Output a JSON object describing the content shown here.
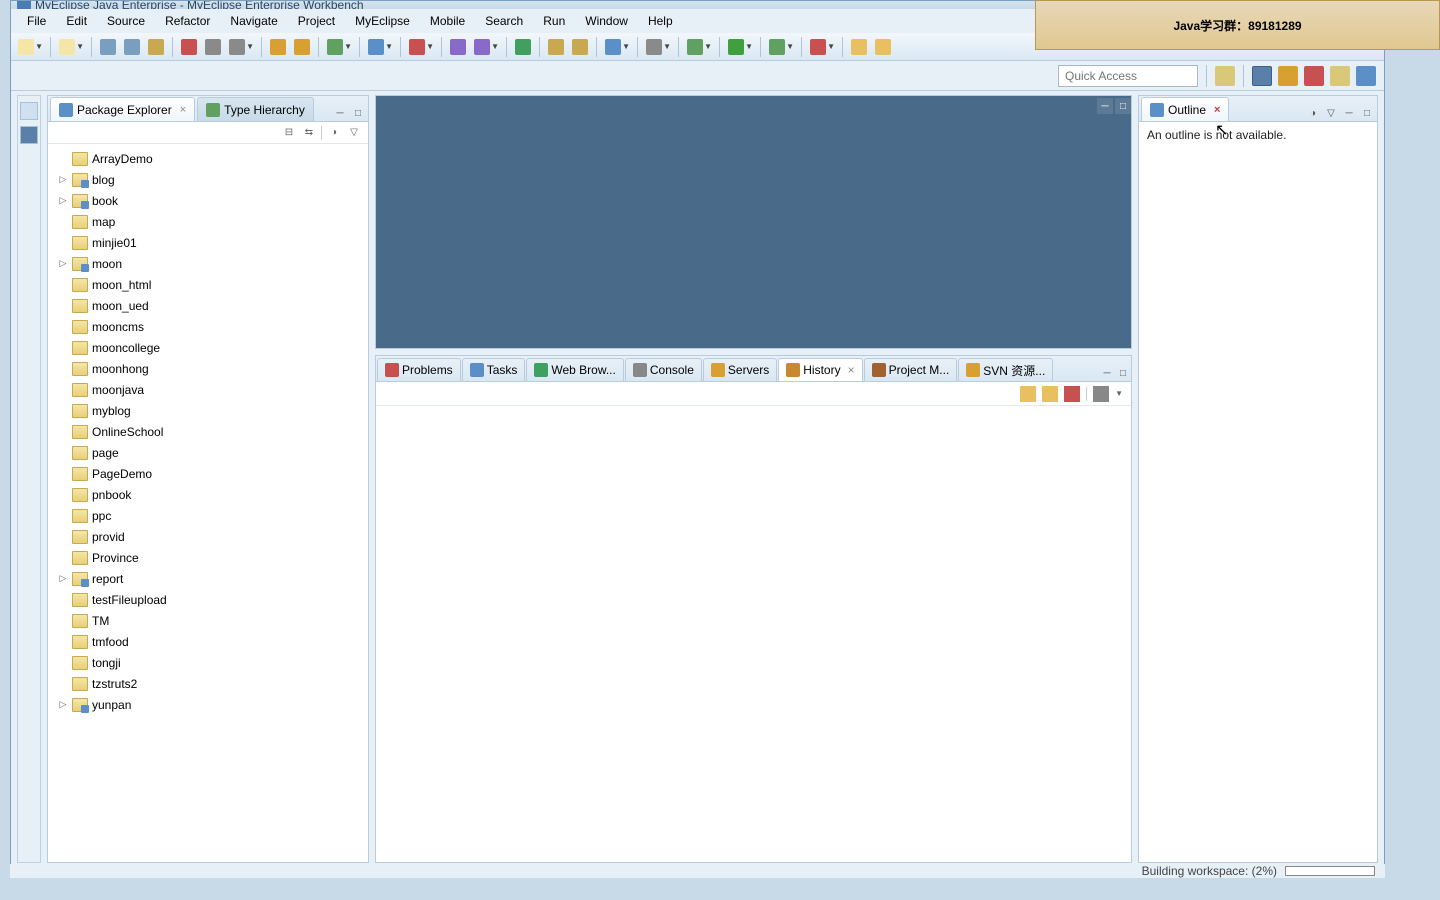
{
  "title": "MyEclipse Java Enterprise - MyEclipse Enterprise Workbench",
  "menu": [
    "File",
    "Edit",
    "Source",
    "Refactor",
    "Navigate",
    "Project",
    "MyEclipse",
    "Mobile",
    "Search",
    "Run",
    "Window",
    "Help"
  ],
  "quickAccess": {
    "placeholder": "Quick Access"
  },
  "leftTabs": {
    "pkg": "Package Explorer",
    "type": "Type Hierarchy"
  },
  "projects": [
    {
      "name": "ArrayDemo",
      "kind": "f",
      "exp": false
    },
    {
      "name": "blog",
      "kind": "p",
      "exp": true
    },
    {
      "name": "book",
      "kind": "p",
      "exp": true
    },
    {
      "name": "map",
      "kind": "f",
      "exp": false
    },
    {
      "name": "minjie01",
      "kind": "f",
      "exp": false
    },
    {
      "name": "moon",
      "kind": "p",
      "exp": true
    },
    {
      "name": "moon_html",
      "kind": "f",
      "exp": false
    },
    {
      "name": "moon_ued",
      "kind": "f",
      "exp": false
    },
    {
      "name": "mooncms",
      "kind": "f",
      "exp": false
    },
    {
      "name": "mooncollege",
      "kind": "f",
      "exp": false
    },
    {
      "name": "moonhong",
      "kind": "f",
      "exp": false
    },
    {
      "name": "moonjava",
      "kind": "f",
      "exp": false
    },
    {
      "name": "myblog",
      "kind": "f",
      "exp": false
    },
    {
      "name": "OnlineSchool",
      "kind": "f",
      "exp": false
    },
    {
      "name": "page",
      "kind": "f",
      "exp": false
    },
    {
      "name": "PageDemo",
      "kind": "f",
      "exp": false
    },
    {
      "name": "pnbook",
      "kind": "f",
      "exp": false
    },
    {
      "name": "ppc",
      "kind": "f",
      "exp": false
    },
    {
      "name": "provid",
      "kind": "f",
      "exp": false
    },
    {
      "name": "Province",
      "kind": "f",
      "exp": false
    },
    {
      "name": "report",
      "kind": "p",
      "exp": true
    },
    {
      "name": "testFileupload",
      "kind": "f",
      "exp": false
    },
    {
      "name": "TM",
      "kind": "f",
      "exp": false
    },
    {
      "name": "tmfood",
      "kind": "f",
      "exp": false
    },
    {
      "name": "tongji",
      "kind": "f",
      "exp": false
    },
    {
      "name": "tzstruts2",
      "kind": "f",
      "exp": false
    },
    {
      "name": "yunpan",
      "kind": "p",
      "exp": true
    }
  ],
  "bottomTabs": [
    {
      "label": "Problems",
      "color": "#c85050"
    },
    {
      "label": "Tasks",
      "color": "#5a8fc8"
    },
    {
      "label": "Web Brow...",
      "color": "#40a060"
    },
    {
      "label": "Console",
      "color": "#888"
    },
    {
      "label": "Servers",
      "color": "#d8a030"
    },
    {
      "label": "History",
      "color": "#c88830",
      "active": true
    },
    {
      "label": "Project M...",
      "color": "#a06030"
    },
    {
      "label": "SVN 资源...",
      "color": "#d8a030"
    }
  ],
  "outline": {
    "tab": "Outline",
    "empty": "An outline is not available."
  },
  "watermark": "Java学习群：89181289",
  "status": "Building workspace: (2%)"
}
